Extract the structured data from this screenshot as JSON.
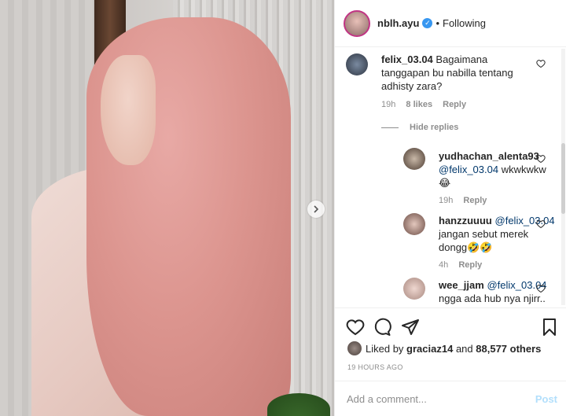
{
  "post": {
    "username": "nblh.ayu",
    "follow_status": "Following",
    "separator": "•"
  },
  "comments": [
    {
      "user": "felix_03.04",
      "text_line1": "Bagaimana",
      "text_line2": "tanggapan bu nabilla tentang",
      "text_line3": "adhisty zara?",
      "time": "19h",
      "likes": "8 likes",
      "reply": "Reply"
    }
  ],
  "hide_replies": "Hide replies",
  "replies": [
    {
      "user": "yudhachan_alenta93",
      "mention": "@felix_03.04",
      "text": "wkwkwkw",
      "emoji": "😂",
      "time": "19h",
      "reply": "Reply"
    },
    {
      "user": "hanzzuuuu",
      "mention": "@felix_03.04",
      "text_line1": "jangan sebut merek",
      "text_line2": "dongg🤣🤣",
      "time": "4h",
      "reply": "Reply"
    },
    {
      "user": "wee_jjam",
      "mention": "@felix_03.04",
      "text_line1": "ngga ada hub nya njirr.."
    }
  ],
  "likes": {
    "prefix": "Liked by",
    "user": "graciaz14",
    "and": "and",
    "count": "88,577 others"
  },
  "timestamp": "19 HOURS AGO",
  "comment_input": {
    "placeholder": "Add a comment..."
  },
  "post_button": "Post",
  "colors": {
    "link": "#00376b",
    "verified": "#3897f0",
    "post_disabled": "#b2dffc"
  }
}
